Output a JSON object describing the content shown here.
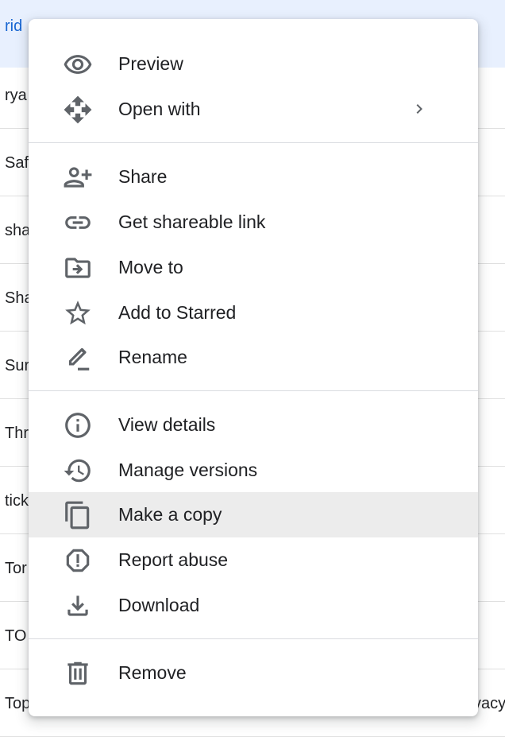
{
  "file_list": {
    "rows": [
      {
        "name": "rid",
        "extra": ""
      },
      {
        "name": "rya",
        "extra": ""
      },
      {
        "name": "Saf",
        "extra": ""
      },
      {
        "name": "sha",
        "extra": ""
      },
      {
        "name": "Sha",
        "extra": ""
      },
      {
        "name": "Sur",
        "extra": ""
      },
      {
        "name": "Thr",
        "extra": ""
      },
      {
        "name": "tick",
        "extra": ""
      },
      {
        "name": "Tor",
        "extra": ""
      },
      {
        "name": "TO",
        "extra": ""
      },
      {
        "name": "Top",
        "extra": "vacy"
      }
    ]
  },
  "context_menu": {
    "items": [
      {
        "label": "Preview",
        "icon": "eye-icon"
      },
      {
        "label": "Open with",
        "icon": "move-arrows-icon",
        "submenu_icon": "chevron-right-icon"
      },
      {
        "label": "Share",
        "icon": "person-add-icon"
      },
      {
        "label": "Get shareable link",
        "icon": "link-icon"
      },
      {
        "label": "Move to",
        "icon": "folder-move-icon"
      },
      {
        "label": "Add to Starred",
        "icon": "star-outline-icon"
      },
      {
        "label": "Rename",
        "icon": "pencil-icon"
      },
      {
        "label": "View details",
        "icon": "info-icon"
      },
      {
        "label": "Manage versions",
        "icon": "history-icon"
      },
      {
        "label": "Make a copy",
        "icon": "copy-icon",
        "highlighted": true
      },
      {
        "label": "Report abuse",
        "icon": "report-icon"
      },
      {
        "label": "Download",
        "icon": "download-icon"
      },
      {
        "label": "Remove",
        "icon": "trash-icon"
      }
    ]
  },
  "colors": {
    "selected_row_bg": "#e8f0fe",
    "selected_row_text": "#1967d2",
    "icon_gray": "#5f6368",
    "text": "#202124",
    "highlight_bg": "#ececec",
    "divider": "#dadce0"
  }
}
